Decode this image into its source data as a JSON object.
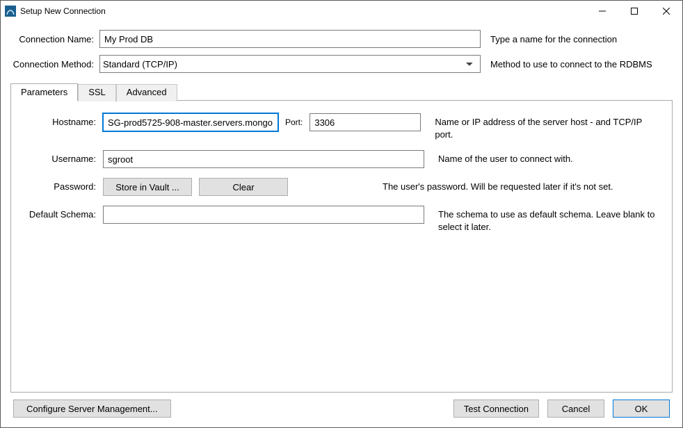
{
  "window": {
    "title": "Setup New Connection"
  },
  "form": {
    "conn_name": {
      "label": "Connection Name:",
      "value": "My Prod DB",
      "hint": "Type a name for the connection"
    },
    "conn_method": {
      "label": "Connection Method:",
      "value": "Standard (TCP/IP)",
      "hint": "Method to use to connect to the RDBMS"
    }
  },
  "tabs": {
    "parameters": "Parameters",
    "ssl": "SSL",
    "advanced": "Advanced"
  },
  "params": {
    "hostname": {
      "label": "Hostname:",
      "value": "SG-prod5725-908-master.servers.mongo",
      "port_label": "Port:",
      "port_value": "3306",
      "hint": "Name or IP address of the server host - and TCP/IP port."
    },
    "username": {
      "label": "Username:",
      "value": "sgroot",
      "hint": "Name of the user to connect with."
    },
    "password": {
      "label": "Password:",
      "store_btn": "Store in Vault ...",
      "clear_btn": "Clear",
      "hint": "The user's password. Will be requested later if it's not set."
    },
    "schema": {
      "label": "Default Schema:",
      "value": "",
      "hint": "The schema to use as default schema. Leave blank to select it later."
    }
  },
  "footer": {
    "configure": "Configure Server Management...",
    "test": "Test Connection",
    "cancel": "Cancel",
    "ok": "OK"
  }
}
